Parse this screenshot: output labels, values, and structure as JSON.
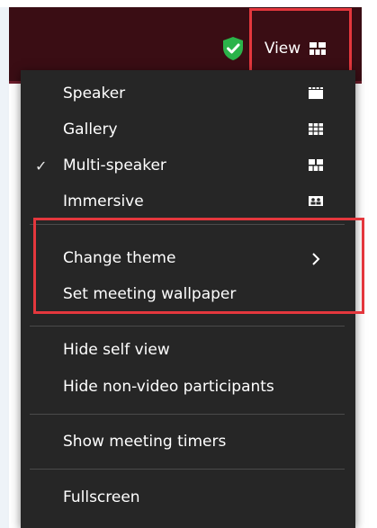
{
  "header": {
    "view_label": "View"
  },
  "menu": {
    "group1": [
      {
        "label": "Speaker",
        "checked": false,
        "icon": "speaker-view-icon"
      },
      {
        "label": "Gallery",
        "checked": false,
        "icon": "gallery-view-icon"
      },
      {
        "label": "Multi-speaker",
        "checked": true,
        "icon": "multi-speaker-view-icon"
      },
      {
        "label": "Immersive",
        "checked": false,
        "icon": "immersive-view-icon"
      }
    ],
    "group2": [
      {
        "label": "Change theme",
        "submenu": true
      },
      {
        "label": "Set meeting wallpaper"
      }
    ],
    "group3": [
      {
        "label": "Hide self view"
      },
      {
        "label": "Hide non-video participants"
      }
    ],
    "group4": [
      {
        "label": "Show meeting timers"
      }
    ],
    "group5": [
      {
        "label": "Fullscreen"
      }
    ],
    "check_mark": "✓",
    "chevron": "›"
  },
  "colors": {
    "menu_bg": "#262626",
    "topbar_bg": "#3a0d14",
    "highlight_box": "#e4373d",
    "shield_green": "#2bb34a"
  }
}
